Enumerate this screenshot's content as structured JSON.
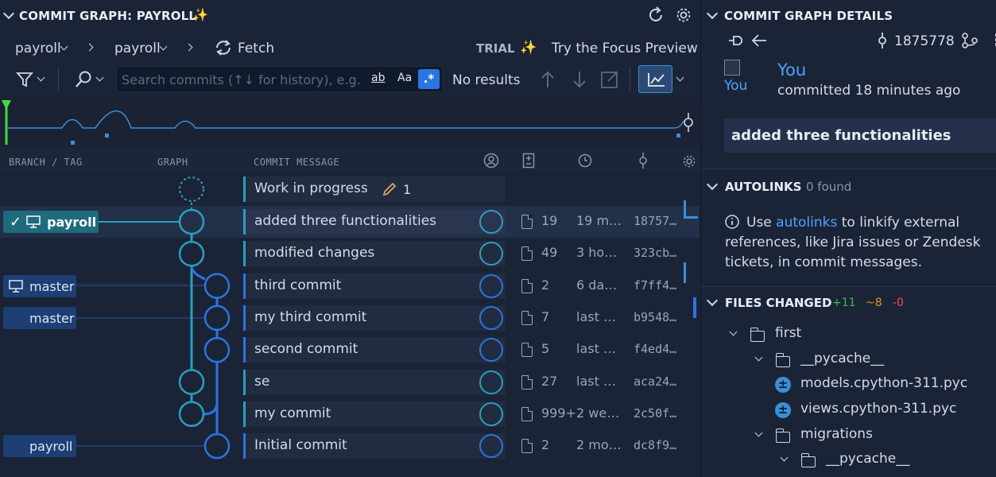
{
  "graph_panel": {
    "title": "COMMIT GRAPH: PAYROLL",
    "repo": "payroll",
    "branch": "payroll",
    "fetch_label": "Fetch",
    "trial_label": "TRIAL",
    "focus_label": "Try the Focus Preview",
    "search_placeholder": "Search commits (↑↓ for history), e.g. \"",
    "search_opt_word": "ab",
    "search_opt_case": "Aa",
    "search_opt_regex": ".*",
    "no_results": "No results",
    "columns": {
      "branch": "BRANCH / TAG",
      "graph": "GRAPH",
      "message": "COMMIT MESSAGE"
    },
    "wip": {
      "message": "Work in progress",
      "count": "1"
    },
    "branch_labels": {
      "payroll_head": "payroll",
      "master_local": "master",
      "master_remote": "master",
      "payroll_remote": "payroll"
    },
    "commits": [
      {
        "message": "added three functionalities",
        "files": "19",
        "date": "19 m…",
        "sha": "18757…"
      },
      {
        "message": "modified changes",
        "files": "49",
        "date": "3 ho…",
        "sha": "323cb…"
      },
      {
        "message": "third commit",
        "files": "2",
        "date": "6 da…",
        "sha": "f7ff4…"
      },
      {
        "message": "my third commit",
        "files": "7",
        "date": "last …",
        "sha": "b9548…"
      },
      {
        "message": "second commit",
        "files": "5",
        "date": "last …",
        "sha": "f4ed4…"
      },
      {
        "message": "se",
        "files": "27",
        "date": "last …",
        "sha": "aca24…"
      },
      {
        "message": "my commit",
        "files": "999+",
        "date": "2 we…",
        "sha": "2c50f…"
      },
      {
        "message": "Initial commit",
        "files": "2",
        "date": "2 mo…",
        "sha": "dc8f9…"
      }
    ]
  },
  "details_panel": {
    "title": "COMMIT GRAPH DETAILS",
    "sha": "1875778",
    "avatar_alt": "You",
    "author": "You",
    "committed": "committed 18 minutes ago",
    "message": "added three functionalities",
    "autolinks": {
      "title": "AUTOLINKS",
      "found": "0 found",
      "text_before": "Use ",
      "link": "autolinks",
      "text_after": " to linkify external references, like Jira issues or Zendesk tickets, in commit messages."
    },
    "files_changed": {
      "title": "FILES CHANGED",
      "added": "+11",
      "modified": "~8",
      "deleted": "-0",
      "tree": [
        {
          "name": "first",
          "type": "folder",
          "depth": 0
        },
        {
          "name": "__pycache__",
          "type": "folder",
          "depth": 1
        },
        {
          "name": "models.cpython-311.pyc",
          "type": "file",
          "depth": 2
        },
        {
          "name": "views.cpython-311.pyc",
          "type": "file",
          "depth": 2
        },
        {
          "name": "migrations",
          "type": "folder",
          "depth": 1
        },
        {
          "name": "__pycache__",
          "type": "folder",
          "depth": 2
        }
      ]
    }
  },
  "colors": {
    "background": "#1b2437",
    "accent_teal": "#2a9fbf",
    "accent_blue": "#2a75e0",
    "link": "#4da3ff",
    "added": "#3fb950",
    "modified": "#d29922",
    "deleted": "#f85149"
  }
}
